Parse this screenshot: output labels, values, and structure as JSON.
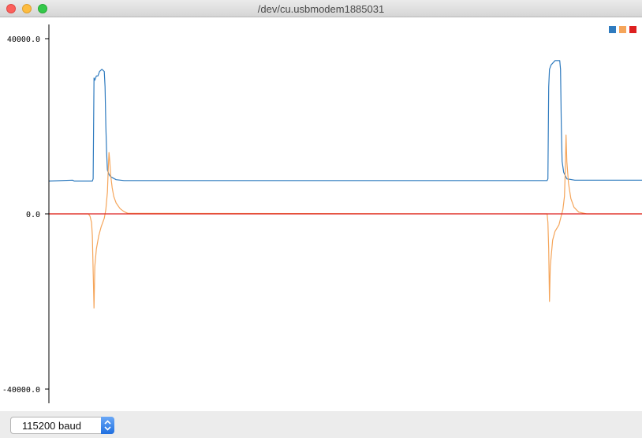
{
  "window": {
    "title": "/dev/cu.usbmodem1885031"
  },
  "toolbar": {
    "baud_label": "115200 baud"
  },
  "chart_data": {
    "type": "line",
    "ylim": [
      -40000,
      40000
    ],
    "yticks": [
      {
        "value": 40000,
        "label": "40000.0"
      },
      {
        "value": 0,
        "label": "0.0"
      },
      {
        "value": -40000,
        "label": "-40000.0"
      }
    ],
    "xlim": [
      0,
      750
    ],
    "grid": false,
    "legend_placement": "top-right",
    "series": [
      {
        "color": "#2f7bbf",
        "points": [
          [
            0,
            7500
          ],
          [
            30,
            7700
          ],
          [
            32,
            7500
          ],
          [
            55,
            7500
          ],
          [
            56,
            8000
          ],
          [
            57,
            31000
          ],
          [
            58,
            30500
          ],
          [
            60,
            31500
          ],
          [
            62,
            31500
          ],
          [
            64,
            32500
          ],
          [
            67,
            33000
          ],
          [
            70,
            32500
          ],
          [
            71,
            29000
          ],
          [
            72,
            20000
          ],
          [
            73,
            14000
          ],
          [
            74,
            10000
          ],
          [
            76,
            9000
          ],
          [
            78,
            8500
          ],
          [
            85,
            7800
          ],
          [
            95,
            7600
          ],
          [
            200,
            7600
          ],
          [
            400,
            7600
          ],
          [
            630,
            7600
          ],
          [
            631,
            8000
          ],
          [
            632,
            29000
          ],
          [
            633,
            33000
          ],
          [
            635,
            34000
          ],
          [
            640,
            35000
          ],
          [
            646,
            35000
          ],
          [
            647,
            33000
          ],
          [
            648,
            20000
          ],
          [
            649,
            12000
          ],
          [
            651,
            9500
          ],
          [
            655,
            8000
          ],
          [
            665,
            7700
          ],
          [
            750,
            7700
          ]
        ]
      },
      {
        "color": "#f5a55a",
        "points": [
          [
            0,
            0
          ],
          [
            50,
            0
          ],
          [
            52,
            -500
          ],
          [
            54,
            -2000
          ],
          [
            55,
            -5000
          ],
          [
            56,
            -13000
          ],
          [
            57,
            -21500
          ],
          [
            58,
            -12000
          ],
          [
            60,
            -8000
          ],
          [
            63,
            -5000
          ],
          [
            66,
            -3000
          ],
          [
            70,
            -1000
          ],
          [
            72,
            1000
          ],
          [
            74,
            5000
          ],
          [
            75,
            10000
          ],
          [
            76,
            14000
          ],
          [
            77,
            12000
          ],
          [
            78,
            9000
          ],
          [
            80,
            6000
          ],
          [
            82,
            4000
          ],
          [
            85,
            2500
          ],
          [
            90,
            1200
          ],
          [
            95,
            500
          ],
          [
            100,
            100
          ],
          [
            630,
            0
          ],
          [
            631,
            -2000
          ],
          [
            632,
            -8000
          ],
          [
            633,
            -20000
          ],
          [
            634,
            -12000
          ],
          [
            637,
            -6000
          ],
          [
            640,
            -4000
          ],
          [
            645,
            -2500
          ],
          [
            650,
            1000
          ],
          [
            652,
            4000
          ],
          [
            653,
            10000
          ],
          [
            654,
            18000
          ],
          [
            655,
            12000
          ],
          [
            657,
            7000
          ],
          [
            660,
            3500
          ],
          [
            664,
            1500
          ],
          [
            670,
            400
          ],
          [
            680,
            0
          ],
          [
            750,
            0
          ]
        ]
      },
      {
        "color": "#dd2020",
        "points": [
          [
            0,
            0
          ],
          [
            750,
            0
          ]
        ]
      }
    ]
  }
}
